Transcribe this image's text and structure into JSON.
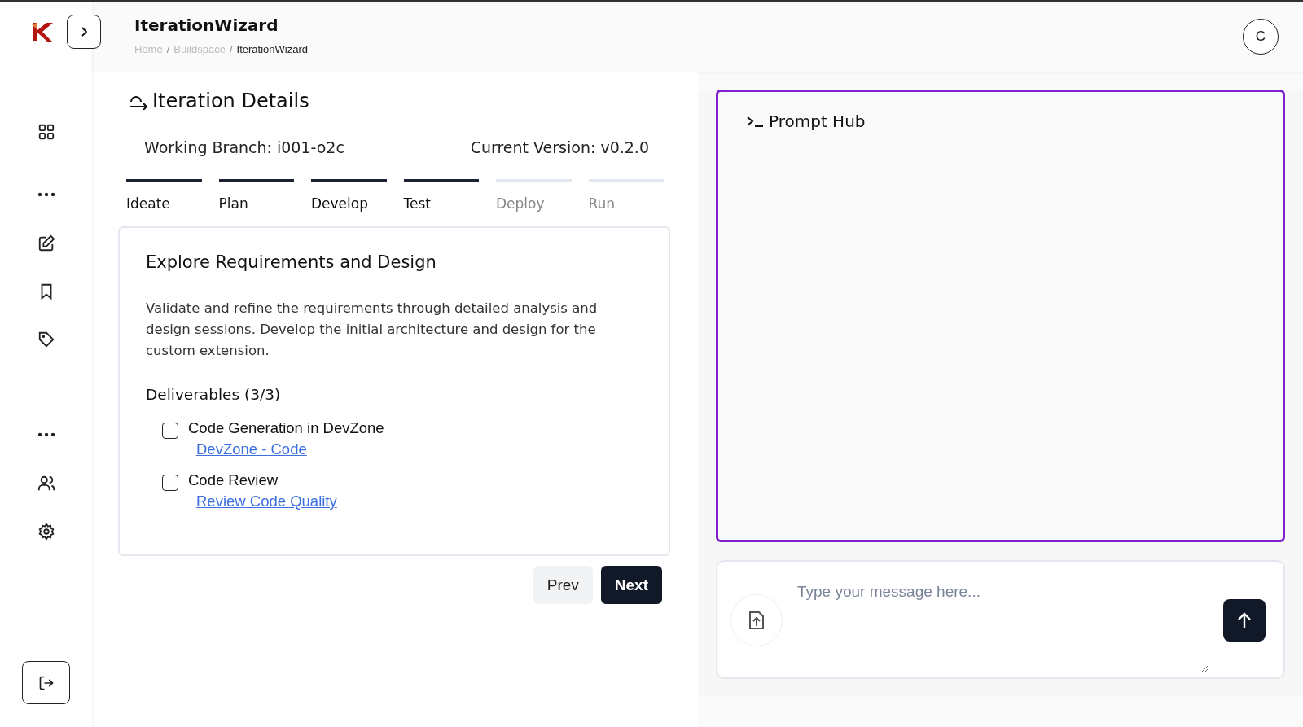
{
  "header": {
    "title": "IterationWizard",
    "breadcrumb": [
      {
        "label": "Home",
        "current": false
      },
      {
        "label": "Buildspace",
        "current": false
      },
      {
        "label": "IterationWizard",
        "current": true
      }
    ],
    "separator": "/",
    "avatar": "C"
  },
  "sidebar": {
    "items": [
      {
        "kind": "grid"
      },
      {
        "kind": "more"
      },
      {
        "kind": "edit"
      },
      {
        "kind": "bookmark"
      },
      {
        "kind": "tag"
      },
      {
        "kind": "more"
      },
      {
        "kind": "users"
      },
      {
        "kind": "settings"
      }
    ]
  },
  "iteration": {
    "title": "Iteration Details",
    "branch": "Working Branch: i001-o2c",
    "version": "Current Version: v0.2.0",
    "steps": [
      {
        "label": "Ideate",
        "done": true
      },
      {
        "label": "Plan",
        "done": true
      },
      {
        "label": "Develop",
        "done": true
      },
      {
        "label": "Test",
        "done": true
      },
      {
        "label": "Deploy",
        "done": false
      },
      {
        "label": "Run",
        "done": false
      }
    ],
    "card": {
      "title": "Explore Requirements and Design",
      "description": "Validate and refine the requirements through detailed analysis and design sessions. Develop the initial architecture and design for the custom extension.",
      "deliverables_title": "Deliverables (3/3)",
      "deliverables": [
        {
          "label": "Code Generation in DevZone",
          "link": "DevZone - Code",
          "checked": false
        },
        {
          "label": "Code Review",
          "link": "Review Code Quality",
          "checked": false
        }
      ]
    },
    "buttons": [
      "Prev",
      "Next"
    ]
  },
  "prompt_hub": {
    "title": "Prompt Hub",
    "placeholder": "Type your message here..."
  }
}
